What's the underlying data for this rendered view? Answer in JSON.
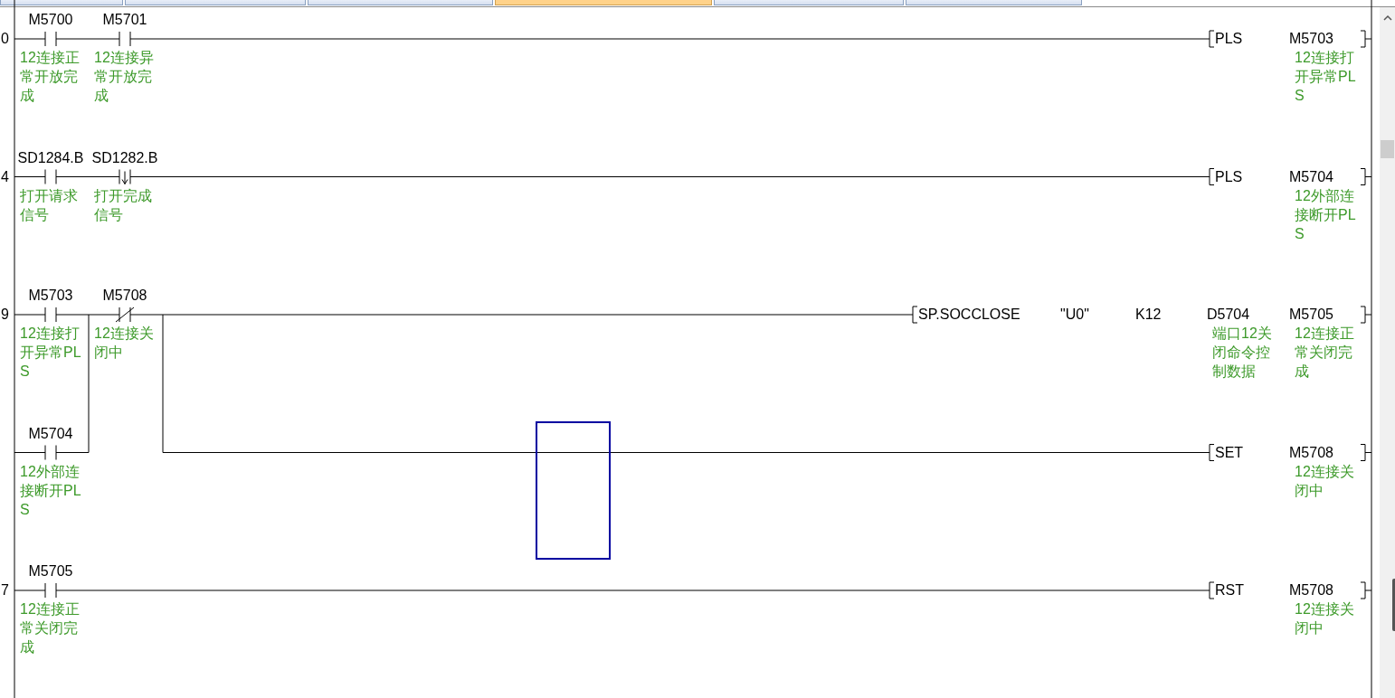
{
  "tabs": [
    {
      "selected": false
    },
    {
      "selected": false
    },
    {
      "selected": false
    },
    {
      "selected": true
    },
    {
      "selected": false
    },
    {
      "selected": false
    }
  ],
  "rungs": [
    {
      "step": "0",
      "rows": [
        {
          "contacts": [
            {
              "device": "M5700",
              "kind": "no",
              "comment": "12连接正常开放完成"
            },
            {
              "device": "M5701",
              "kind": "no",
              "comment": "12连接异常开放完成"
            }
          ],
          "output": {
            "mnemonic": "PLS",
            "operands": [
              {
                "text": "M5703",
                "comment": "12连接打开异常PLS"
              }
            ]
          }
        }
      ]
    },
    {
      "step": "4",
      "rows": [
        {
          "contacts": [
            {
              "device": "SD1284.B",
              "kind": "no",
              "comment": "打开请求信号"
            },
            {
              "device": "SD1282.B",
              "kind": "fall",
              "comment": "打开完成信号"
            }
          ],
          "output": {
            "mnemonic": "PLS",
            "operands": [
              {
                "text": "M5704",
                "comment": "12外部连接断开PLS"
              }
            ]
          }
        }
      ]
    },
    {
      "step": "9",
      "rows": [
        {
          "contacts": [
            {
              "device": "M5703",
              "kind": "no",
              "comment": "12连接打开异常PLS"
            },
            {
              "device": "M5708",
              "kind": "nc",
              "comment": "12连接关闭中"
            }
          ],
          "output": {
            "mnemonic": "SP.SOCCLOSE",
            "operands": [
              {
                "text": "\"U0\""
              },
              {
                "text": "K12"
              },
              {
                "text": "D5704",
                "comment": "端口12关闭命令控制数据"
              },
              {
                "text": "M5705",
                "comment": "12连接正常关闭完成"
              }
            ]
          }
        },
        {
          "contacts": [
            {
              "device": "M5704",
              "kind": "no",
              "comment": "12外部连接断开PLS"
            }
          ],
          "output": {
            "mnemonic": "SET",
            "operands": [
              {
                "text": "M5708",
                "comment": "12连接关闭中"
              }
            ]
          }
        }
      ]
    },
    {
      "step": "7",
      "rows": [
        {
          "contacts": [
            {
              "device": "M5705",
              "kind": "no",
              "comment": "12连接正常关闭完成"
            }
          ],
          "output": {
            "mnemonic": "RST",
            "operands": [
              {
                "text": "M5708",
                "comment": "12连接关闭中"
              }
            ]
          }
        }
      ]
    }
  ]
}
